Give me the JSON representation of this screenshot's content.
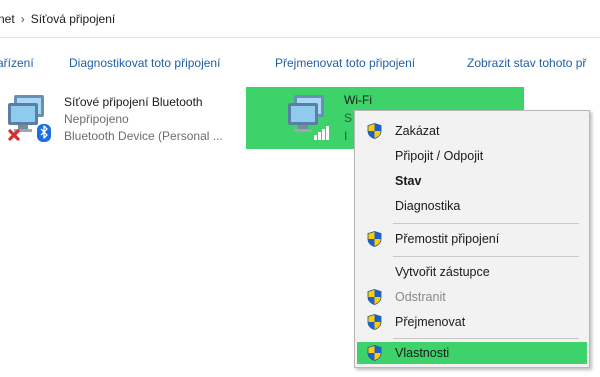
{
  "breadcrumb": {
    "segments": [
      "rnet",
      "Síťová připojení"
    ],
    "separator": "›"
  },
  "toolbar": {
    "commands": [
      "ařízení",
      "Diagnostikovat toto připojení",
      "Přejmenovat toto připojení",
      "Zobrazit stav tohoto př"
    ]
  },
  "connections": [
    {
      "name": "Síťové připojení Bluetooth",
      "status": "Nepřipojeno",
      "device": "Bluetooth Device (Personal ...",
      "icon": "network-bluetooth-disconnected-icon"
    },
    {
      "name": "Wi-Fi",
      "status": "S",
      "device": "I",
      "icon": "network-wifi-icon",
      "selected_color": "#3ed26b"
    }
  ],
  "context_menu": {
    "items": [
      {
        "label": "Zakázat",
        "shield": true
      },
      {
        "label": "Připojit / Odpojit",
        "shield": false
      },
      {
        "label": "Stav",
        "shield": false,
        "bold": true
      },
      {
        "label": "Diagnostika",
        "shield": false
      },
      {
        "label": "Přemostit připojení",
        "shield": true
      },
      {
        "label": "Vytvořit zástupce",
        "shield": false
      },
      {
        "label": "Odstranit",
        "shield": true,
        "disabled": true
      },
      {
        "label": "Přejmenovat",
        "shield": true
      },
      {
        "label": "Vlastnosti",
        "shield": true,
        "highlighted": true
      }
    ],
    "highlight_color": "#3ed26b"
  }
}
